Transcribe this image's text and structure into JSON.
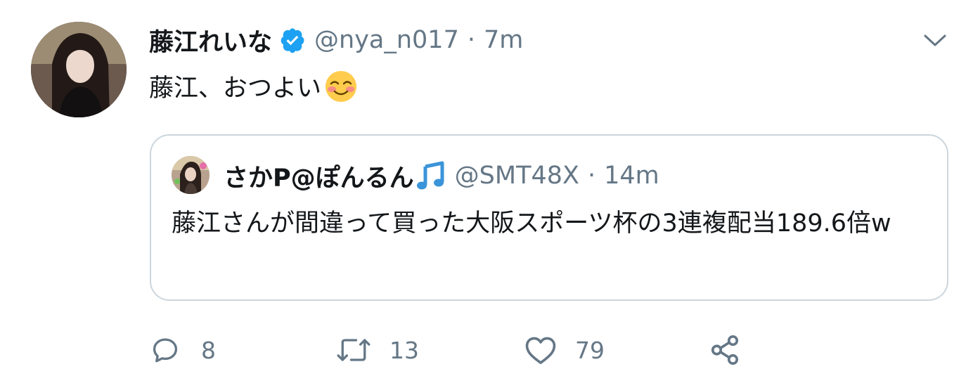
{
  "tweet": {
    "display_name": "藤江れいな",
    "handle": "@nya_n017",
    "separator": "·",
    "time": "7m",
    "text": "藤江、おつよい",
    "emoji": "smiling-face-with-blush",
    "verified": true,
    "verified_color": "#1da1f2"
  },
  "quote": {
    "display_name": "さかP@ぽんるん",
    "name_emoji": "musical-note-icon",
    "handle": "@SMT48X",
    "separator": "·",
    "time": "14m",
    "text": "藤江さんが間違って買った大阪スポーツ杯の3連複配当189.6倍w"
  },
  "actions": {
    "reply_count": "8",
    "retweet_count": "13",
    "like_count": "79"
  },
  "colors": {
    "text_primary": "#14171a",
    "text_secondary": "#657786",
    "border": "#ccd6dd",
    "accent": "#1da1f2"
  }
}
